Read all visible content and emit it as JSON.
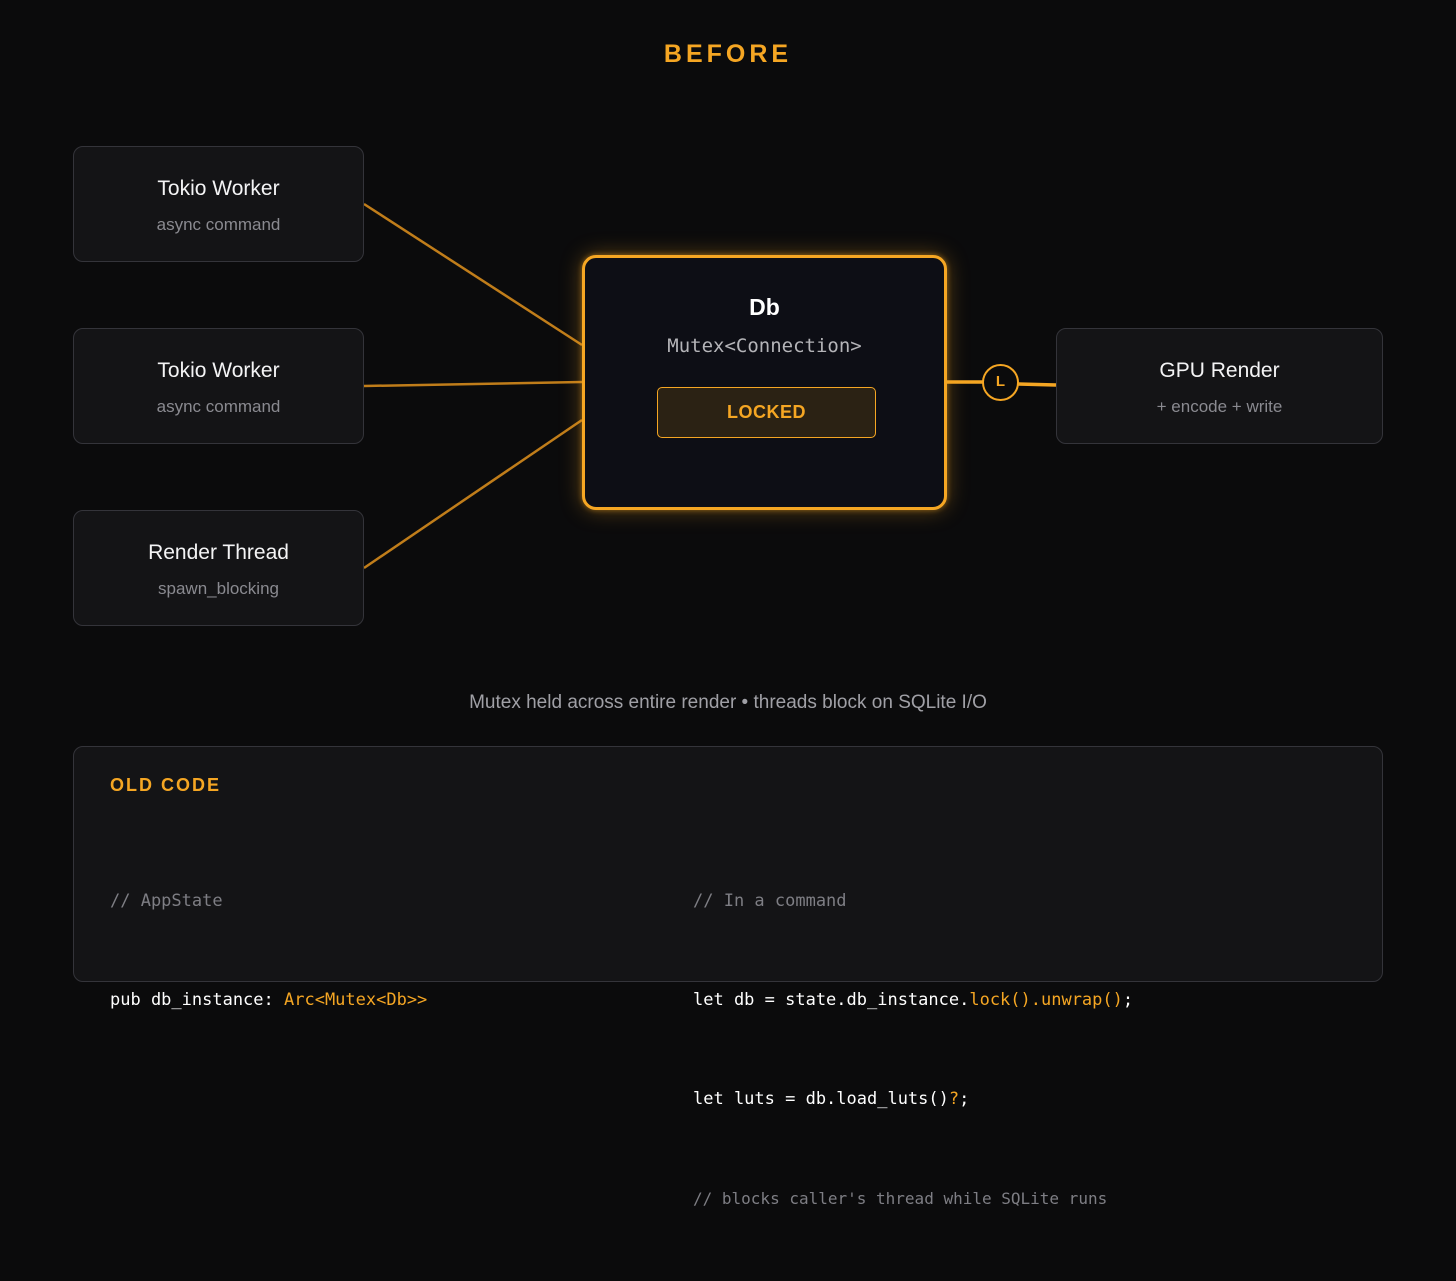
{
  "title": "BEFORE",
  "nodes": {
    "worker1": {
      "title": "Tokio Worker",
      "subtitle": "async command"
    },
    "worker2": {
      "title": "Tokio Worker",
      "subtitle": "async command"
    },
    "render_thread": {
      "title": "Render Thread",
      "subtitle": "spawn_blocking"
    },
    "gpu": {
      "title": "GPU Render",
      "subtitle": "+ encode + write"
    }
  },
  "db": {
    "title": "Db",
    "subtitle": "Mutex<Connection>",
    "badge": "LOCKED"
  },
  "lock_marker": "L",
  "caption": "Mutex held across entire render • threads block on SQLite I/O",
  "code": {
    "heading": "OLD CODE",
    "left": {
      "comment": "// AppState",
      "line1_plain": "pub db_instance: ",
      "line1_type": "Arc<Mutex<Db>>"
    },
    "right": {
      "comment": "// In a command",
      "line1_plain": "let db = state.db_instance.",
      "line1_hl": "lock().unwrap()",
      "line1_end": ";",
      "line2_plain": "let luts = db.load_luts()",
      "line2_hl": "?",
      "line2_end": ";",
      "comment2": "// blocks caller's thread while SQLite runs"
    }
  },
  "colors": {
    "accent": "#f5a623",
    "background": "#0b0b0c",
    "panel": "#141416",
    "db_fill": "#0d0e15"
  }
}
